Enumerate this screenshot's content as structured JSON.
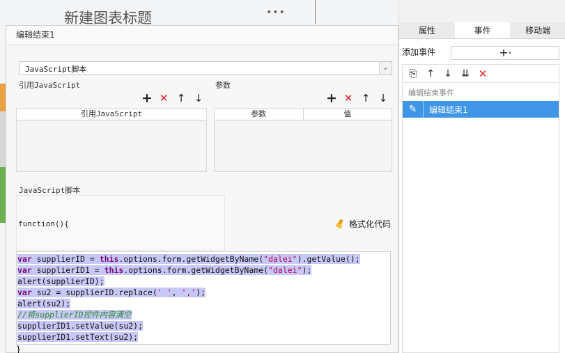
{
  "background": {
    "chart_title": "新建图表标题",
    "more": "•••"
  },
  "dialog": {
    "title": "编辑结束1",
    "script_type": "JavaScript脚本",
    "ref_js_label": "引用JavaScript",
    "params_label": "参数",
    "ref_table_header": "引用JavaScript",
    "param_table_headers": [
      "参数",
      "值"
    ],
    "script_section_label": "JavaScript脚本",
    "function_header": "function(){",
    "format_code_label": "格式化代码",
    "closing_brace": "}"
  },
  "code_lines": [
    [
      {
        "t": "var",
        "c": "kw"
      },
      {
        "t": " supplierID = ",
        "c": "plain"
      },
      {
        "t": "this",
        "c": "kw"
      },
      {
        "t": ".options.form.getWidgetByName(",
        "c": "plain"
      },
      {
        "t": "\"dalei\"",
        "c": "str"
      },
      {
        "t": ").getValue();",
        "c": "plain"
      }
    ],
    [
      {
        "t": "var",
        "c": "kw"
      },
      {
        "t": " supplierID1 = ",
        "c": "plain"
      },
      {
        "t": "this",
        "c": "kw"
      },
      {
        "t": ".options.form.getWidgetByName(",
        "c": "plain"
      },
      {
        "t": "\"dalei\"",
        "c": "str"
      },
      {
        "t": ");",
        "c": "plain"
      }
    ],
    [
      {
        "t": "alert(supplierID);",
        "c": "plain"
      }
    ],
    [
      {
        "t": "var",
        "c": "kw"
      },
      {
        "t": " su2 = supplierID.replace(",
        "c": "plain"
      },
      {
        "t": "' '",
        "c": "str"
      },
      {
        "t": ", ",
        "c": "plain"
      },
      {
        "t": "','",
        "c": "str"
      },
      {
        "t": ");",
        "c": "plain"
      }
    ],
    [
      {
        "t": "alert(su2);",
        "c": "plain"
      }
    ],
    [
      {
        "t": "//将supplierID控件内容清空",
        "c": "cm"
      }
    ],
    [
      {
        "t": "supplierID1.setValue(su2);",
        "c": "plain"
      }
    ],
    [
      {
        "t": "supplierID1.setText(su2);",
        "c": "plain"
      }
    ]
  ],
  "right_panel": {
    "tabs": [
      "属性",
      "事件",
      "移动端"
    ],
    "active_tab": "事件",
    "add_event_label": "添加事件",
    "add_button": "+",
    "event_group_label": "编辑结束事件",
    "event_item": "编辑结束1"
  }
}
